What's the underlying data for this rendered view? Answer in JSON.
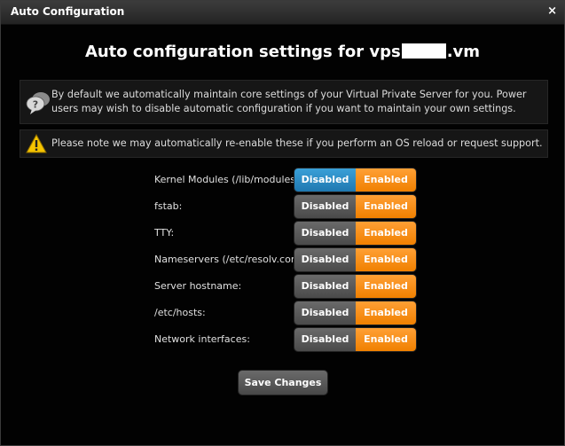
{
  "window": {
    "title": "Auto Configuration",
    "close_glyph": "×"
  },
  "heading": {
    "prefix": "Auto configuration settings for vps",
    "suffix": ".vm"
  },
  "info": {
    "icon": "speech-bubbles-question-icon",
    "text": "By default we automatically maintain core settings of your Virtual Private Server for you. Power users may wish to disable automatic configuration if you want to maintain your own settings."
  },
  "warning": {
    "icon": "warning-triangle-icon",
    "text": "Please note we may automatically re-enable these if you perform an OS reload or request support."
  },
  "settings": [
    {
      "label": "Kernel Modules (/lib/modules):",
      "off_label": "Disabled",
      "on_label": "Enabled",
      "selected": "Disabled"
    },
    {
      "label": "fstab:",
      "off_label": "Disabled",
      "on_label": "Enabled",
      "selected": "Enabled"
    },
    {
      "label": "TTY:",
      "off_label": "Disabled",
      "on_label": "Enabled",
      "selected": "Enabled"
    },
    {
      "label": "Nameservers (/etc/resolv.conf):",
      "off_label": "Disabled",
      "on_label": "Enabled",
      "selected": "Enabled"
    },
    {
      "label": "Server hostname:",
      "off_label": "Disabled",
      "on_label": "Enabled",
      "selected": "Enabled"
    },
    {
      "label": "/etc/hosts:",
      "off_label": "Disabled",
      "on_label": "Enabled",
      "selected": "Enabled"
    },
    {
      "label": "Network interfaces:",
      "off_label": "Disabled",
      "on_label": "Enabled",
      "selected": "Enabled"
    }
  ],
  "save_label": "Save Changes",
  "colors": {
    "enabled": "#f08000",
    "disabled_active": "#1f78b0",
    "disabled_inactive": "#555555"
  }
}
